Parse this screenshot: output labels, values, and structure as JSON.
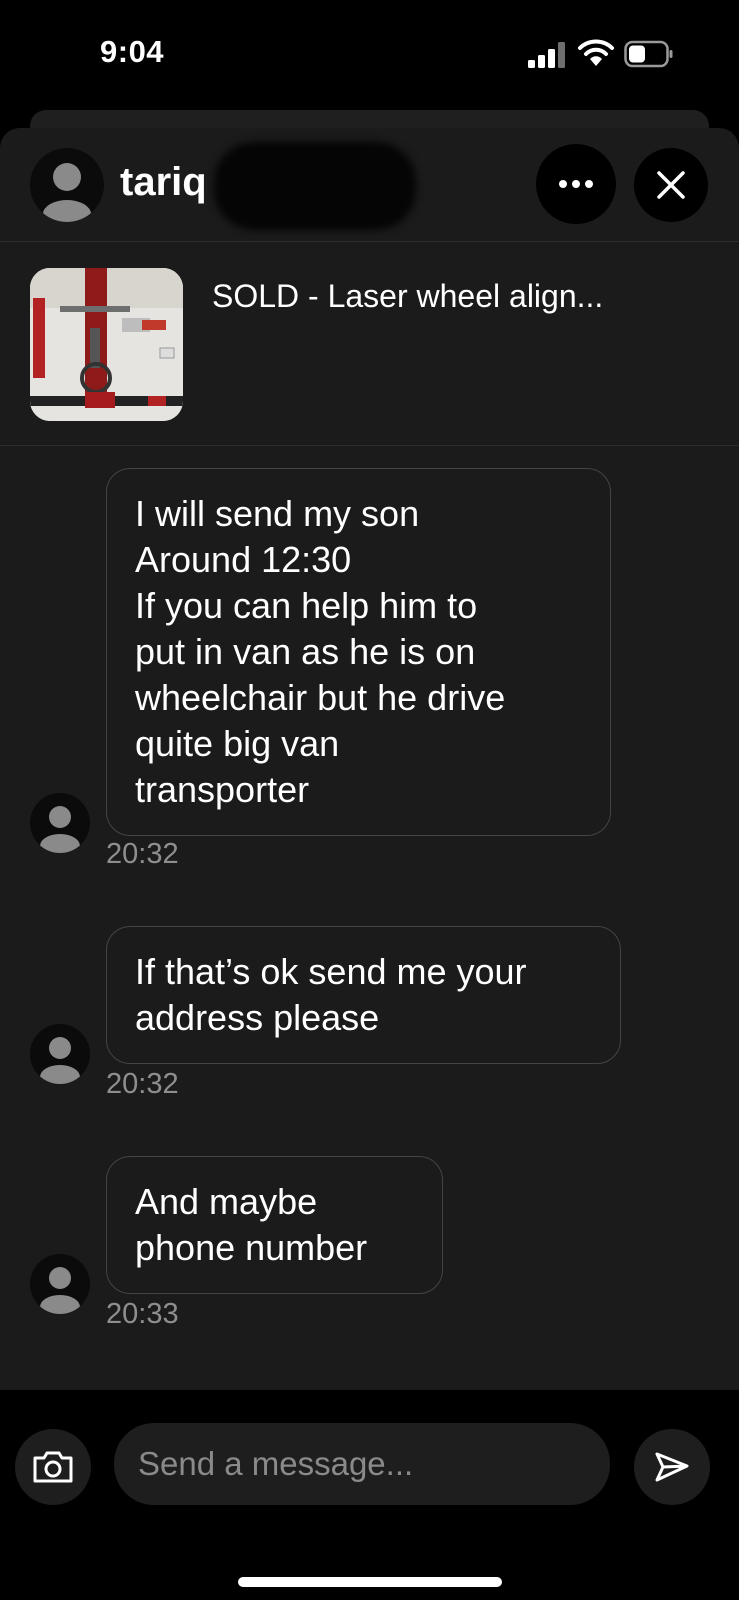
{
  "status_bar": {
    "time": "9:04",
    "icons": [
      "signal-icon",
      "wifi-icon",
      "battery-icon"
    ]
  },
  "header": {
    "username": "tariq",
    "more_icon": "more-horizontal-icon",
    "close_icon": "close-icon"
  },
  "listing": {
    "title": "SOLD - Laser wheel align..."
  },
  "messages": [
    {
      "lines": [
        "I will send my son",
        "Around 12:30",
        "If you can help him to",
        "put in van as he is on",
        "wheelchair but he drive",
        "quite big van",
        "transporter"
      ],
      "time": "20:32"
    },
    {
      "lines": [
        "If that’s ok send me your",
        "address please"
      ],
      "time": "20:32"
    },
    {
      "lines": [
        "And maybe",
        "phone number"
      ],
      "time": "20:33"
    }
  ],
  "composer": {
    "placeholder": "Send a message...",
    "camera_icon": "camera-icon",
    "send_icon": "send-icon"
  },
  "colors": {
    "background": "#000000",
    "sheet": "#1b1b1b",
    "bubble_border": "#444444",
    "timestamp": "#8e8e8e"
  }
}
